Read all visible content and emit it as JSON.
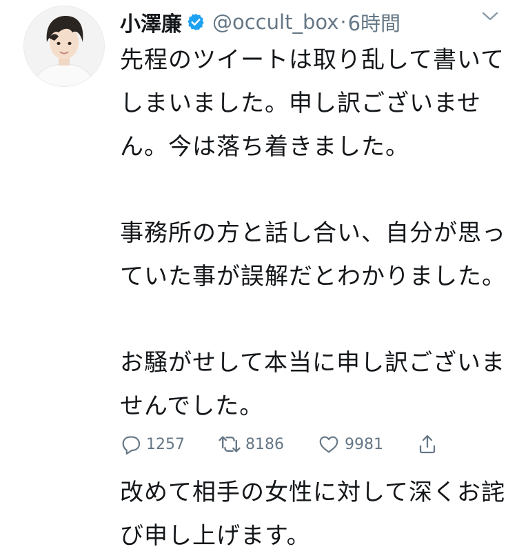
{
  "tweet": {
    "display_name": "小澤廉",
    "handle": "@occult_box",
    "separator": "·",
    "time": "6時間",
    "paragraphs": [
      "先程のツイートは取り乱して書いてしまいました。申し訳ございません。今は落ち着きました。",
      "事務所の方と話し合い、自分が思っていた事が誤解だとわかりました。",
      "お騒がせして本当に申し訳ございませんでした。",
      "改めて相手の女性に対して深くお詫び申し上げます。"
    ]
  },
  "actions": {
    "reply_count": "1257",
    "retweet_count": "8186",
    "like_count": "9981"
  },
  "icons": {
    "verified": "verified-badge-icon",
    "more": "chevron-down-icon",
    "reply": "reply-icon",
    "retweet": "retweet-icon",
    "like": "heart-icon",
    "share": "share-icon"
  },
  "colors": {
    "text": "#14171a",
    "secondary": "#657786",
    "verified": "#1da1f2"
  }
}
